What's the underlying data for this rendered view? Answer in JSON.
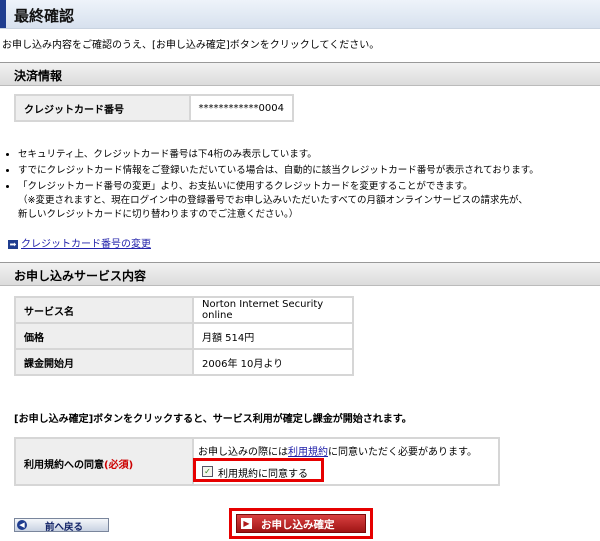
{
  "header": {
    "title": "最終確認"
  },
  "intro": "お申し込み内容をご確認のうえ、[お申し込み確定]ボタンをクリックしてください。",
  "payment": {
    "section_title": "決済情報",
    "card_label": "クレジットカード番号",
    "card_value": "************0004",
    "notes": [
      "セキュリティ上、クレジットカード番号は下4桁のみ表示しています。",
      "すでにクレジットカード情報をご登録いただいている場合は、自動的に該当クレジットカード番号が表示されております。",
      "「クレジットカード番号の変更」より、お支払いに使用するクレジットカードを変更することができます。",
      "（※変更されますと、現在ログイン中の登録番号でお申し込みいただいたすべての月額オンラインサービスの請求先が、",
      "新しいクレジットカードに切り替わりますのでご注意ください。）"
    ],
    "change_link": "クレジットカード番号の変更"
  },
  "service": {
    "section_title": "お申し込みサービス内容",
    "rows": [
      {
        "label": "サービス名",
        "value": "Norton Internet Security online"
      },
      {
        "label": "価格",
        "value": "月額 514円"
      },
      {
        "label": "課金開始月",
        "value": "2006年 10月より"
      }
    ]
  },
  "notice": "[お申し込み確定]ボタンをクリックすると、サービス利用が確定し課金が開始されます。",
  "agreement": {
    "label": "利用規約への同意",
    "required": "(必須)",
    "message_before": "お申し込みの際には",
    "message_link": "利用規約",
    "message_after": "に同意いただく必要があります。",
    "checkbox_label": "利用規約に同意する",
    "checked": true
  },
  "buttons": {
    "back": "前へ戻る",
    "submit": "お申し込み確定"
  },
  "colors": {
    "accent": "#1f3d8f",
    "highlight": "#e60000",
    "submit": "#b01a1a",
    "link": "#2222aa"
  }
}
